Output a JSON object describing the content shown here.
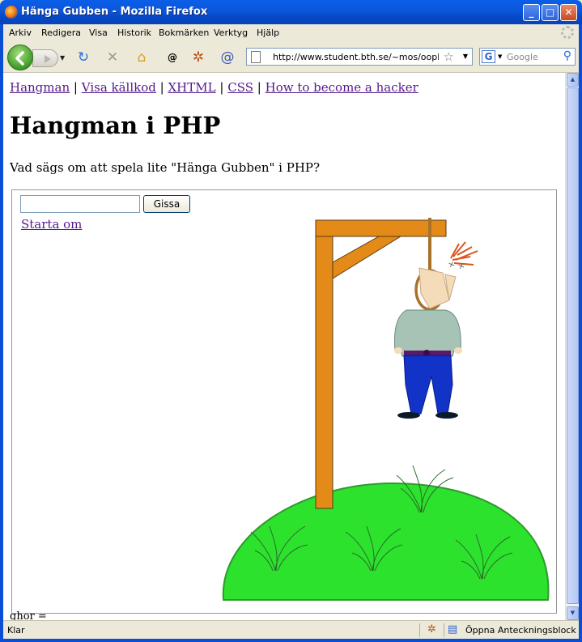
{
  "window": {
    "title": "Hänga Gubben - Mozilla Firefox",
    "controls": [
      "minimize",
      "maximize",
      "close"
    ]
  },
  "menu": [
    "Arkiv",
    "Redigera",
    "Visa",
    "Historik",
    "Bokmärken",
    "Verktyg",
    "Hjälp"
  ],
  "toolbar": {
    "url": "http://www.student.bth.se/~mos/oophp/r",
    "search_placeholder": "Google",
    "search_engine_letter": "G"
  },
  "page": {
    "nav_links": [
      "Hangman",
      "Visa källkod",
      "XHTML",
      "CSS",
      "How to become a hacker"
    ],
    "nav_separator": "|",
    "title": "Hangman i PHP",
    "intro": "Vad sägs om att spela lite \"Hänga Gubben\" i PHP?",
    "game": {
      "guess_value": "",
      "guess_button": "Gissa",
      "restart_link": "Starta om"
    },
    "cut_off_text": "ghor ="
  },
  "statusbar": {
    "text": "Klar",
    "notepad_label": "Öppna Anteckningsblock"
  },
  "colors": {
    "gallows": "#E38A18",
    "hill": "#2DE22D",
    "hill_edge": "#2E9A2E",
    "rope": "#A8722A",
    "shirt": "#A7C3B6",
    "pants": "#1233C8",
    "link": "#551A8B"
  }
}
